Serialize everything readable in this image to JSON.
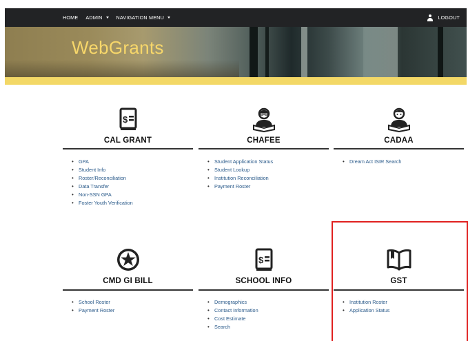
{
  "navbar": {
    "home": "HOME",
    "admin": "ADMIN",
    "navigation_menu": "NAVIGATION MENU",
    "logout": "LOGOUT"
  },
  "banner": {
    "title": "WebGrants"
  },
  "tiles": [
    {
      "title": "CAL GRANT",
      "icon": "dollar-document-icon",
      "items": [
        "GPA",
        "Student Info",
        "Roster/Reconciliation",
        "Data Transfer",
        "Non-SSN GPA",
        "Foster Youth Verification"
      ]
    },
    {
      "title": "CHAFEE",
      "icon": "student-reading-icon",
      "items": [
        "Student Application Status",
        "Student Lookup",
        "Institution Reconciliation",
        "Payment Roster"
      ]
    },
    {
      "title": "CADAA",
      "icon": "student-reading-icon",
      "items": [
        "Dream Act ISIR Search"
      ]
    },
    {
      "title": "CMD GI BILL",
      "icon": "star-medal-icon",
      "items": [
        "School Roster",
        "Payment Roster"
      ]
    },
    {
      "title": "SCHOOL INFO",
      "icon": "dollar-document-icon",
      "items": [
        "Demographics",
        "Contact Information",
        "Cost Estimate",
        "Search"
      ]
    },
    {
      "title": "GST",
      "icon": "open-book-icon",
      "items": [
        "Institution Roster",
        "Application Status"
      ]
    }
  ],
  "colors": {
    "navbar_bg": "#222325",
    "banner_title": "#f7d76a",
    "accent_bar": "#f3d867",
    "link": "#2a5a8a",
    "highlight": "#e0201f"
  }
}
